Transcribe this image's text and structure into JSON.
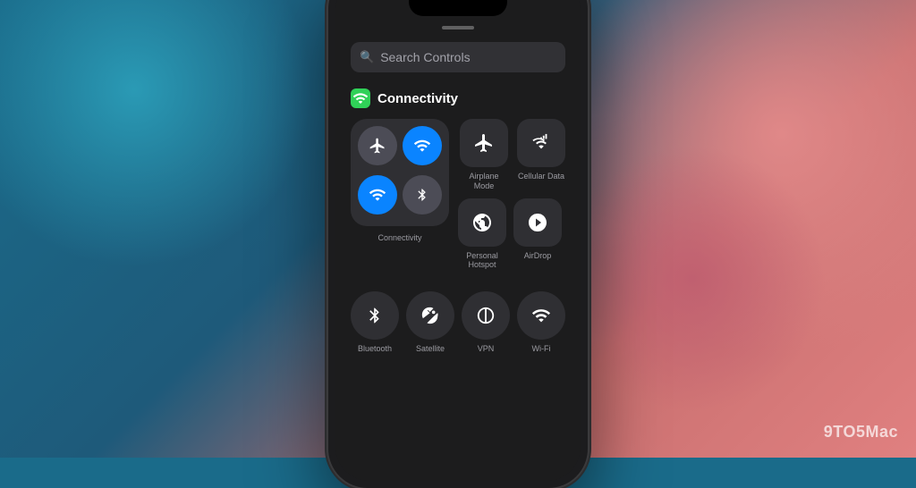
{
  "background": {
    "primary_color": "#1a6b8a",
    "secondary_color": "#e08080"
  },
  "watermark": {
    "text": "9TO5Mac"
  },
  "phone": {
    "screen": {
      "search": {
        "placeholder": "Search Controls",
        "icon": "magnifying-glass"
      },
      "connectivity_section": {
        "title": "Connectivity",
        "icon_color": "#30d158"
      },
      "cluster": {
        "label": "Connectivity",
        "buttons": [
          {
            "id": "airplane",
            "icon": "airplane",
            "active": false
          },
          {
            "id": "wifi-cluster",
            "icon": "wifi",
            "active": true
          },
          {
            "id": "cellular-cluster",
            "icon": "cellular",
            "active": true
          },
          {
            "id": "bluetooth-cluster",
            "icon": "bluetooth",
            "active": false
          }
        ]
      },
      "right_controls": [
        {
          "id": "airplane-mode",
          "label": "Airplane Mode",
          "icon": "airplane"
        },
        {
          "id": "cellular-data",
          "label": "Cellular Data",
          "icon": "cellular"
        },
        {
          "id": "personal-hotspot",
          "label": "Personal\nHotspot",
          "icon": "hotspot"
        },
        {
          "id": "airdrop",
          "label": "AirDrop",
          "icon": "airdrop"
        }
      ],
      "bottom_controls": [
        {
          "id": "bluetooth",
          "label": "Bluetooth",
          "icon": "bluetooth"
        },
        {
          "id": "satellite",
          "label": "Satellite",
          "icon": "satellite"
        },
        {
          "id": "vpn",
          "label": "VPN",
          "icon": "vpn"
        },
        {
          "id": "wifi",
          "label": "Wi-Fi",
          "icon": "wifi"
        }
      ]
    }
  }
}
